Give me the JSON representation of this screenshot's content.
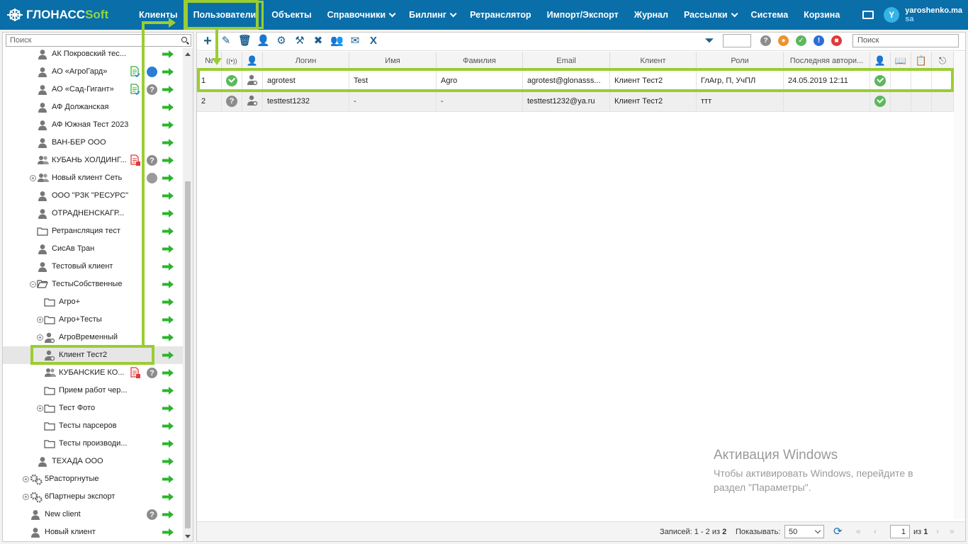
{
  "brand": {
    "name": "ГЛОНАСС",
    "suffix": "Soft"
  },
  "nav": {
    "items": [
      {
        "label": "Клиенты",
        "dropdown": false
      },
      {
        "label": "Пользователи",
        "dropdown": false,
        "active": true
      },
      {
        "label": "Объекты",
        "dropdown": false
      },
      {
        "label": "Справочники",
        "dropdown": true
      },
      {
        "label": "Биллинг",
        "dropdown": true
      },
      {
        "label": "Ретранслятор",
        "dropdown": false
      },
      {
        "label": "Импорт/Экспорт",
        "dropdown": false
      },
      {
        "label": "Журнал",
        "dropdown": false
      },
      {
        "label": "Рассылки",
        "dropdown": true
      },
      {
        "label": "Система",
        "dropdown": false
      },
      {
        "label": "Корзина",
        "dropdown": false
      }
    ]
  },
  "user": {
    "avatar_letter": "Y",
    "login": "yaroshenko.ma",
    "role": "sa"
  },
  "sidebar": {
    "search_placeholder": "Поиск",
    "items": [
      {
        "label": "АК Покровский тес...",
        "icon": "user-icon",
        "indent": 2
      },
      {
        "label": "АО «АгроГард»",
        "icon": "user-icon",
        "indent": 2,
        "doc": "green",
        "badge": "gear"
      },
      {
        "label": "АО «Сад-Гигант»",
        "icon": "user-icon",
        "indent": 2,
        "doc": "green",
        "badge": "?"
      },
      {
        "label": "АФ Должанская",
        "icon": "user-icon",
        "indent": 2
      },
      {
        "label": "АФ Южная Тест 2023",
        "icon": "user-icon",
        "indent": 2
      },
      {
        "label": "ВАН-БЕР ООО",
        "icon": "user-icon",
        "indent": 2
      },
      {
        "label": "КУБАНЬ ХОЛДИНГ...",
        "icon": "users-icon",
        "indent": 2,
        "doc": "red",
        "badge": "?"
      },
      {
        "label": "Новый клиент Сеть",
        "icon": "users-icon",
        "indent": 2,
        "expander": "+",
        "badge": "lock"
      },
      {
        "label": "ООО \"РЗК \"РЕСУРС\"",
        "icon": "user-icon",
        "indent": 2
      },
      {
        "label": "ОТРАДНЕНСКАГР...",
        "icon": "user-icon",
        "indent": 2
      },
      {
        "label": "Ретрансляция тест",
        "icon": "folder-icon",
        "indent": 2
      },
      {
        "label": "СисАв Тран",
        "icon": "user-icon",
        "indent": 2
      },
      {
        "label": "Тестовый клиент",
        "icon": "user-icon",
        "indent": 2
      },
      {
        "label": "ТестыСобственные",
        "icon": "folder-open-icon",
        "indent": 2,
        "expander": "−"
      },
      {
        "label": "Агро+",
        "icon": "folder-icon",
        "indent": 3
      },
      {
        "label": "Агро+Тесты",
        "icon": "folder-icon",
        "indent": 3,
        "expander": "+"
      },
      {
        "label": "АгроВременный",
        "icon": "user-gear-icon",
        "indent": 3,
        "expander": "+"
      },
      {
        "label": "Клиент Тест2",
        "icon": "user-gear-icon",
        "indent": 3,
        "selected": true
      },
      {
        "label": "КУБАНСКИЕ КО...",
        "icon": "users-icon",
        "indent": 3,
        "doc": "red",
        "badge": "?"
      },
      {
        "label": "Прием работ чер...",
        "icon": "folder-icon",
        "indent": 3
      },
      {
        "label": "Тест Фото",
        "icon": "folder-icon",
        "indent": 3,
        "expander": "+"
      },
      {
        "label": "Тесты парсеров",
        "icon": "folder-icon",
        "indent": 3
      },
      {
        "label": "Тесты производи...",
        "icon": "folder-icon",
        "indent": 3
      },
      {
        "label": "ТЕХАДА ООО",
        "icon": "user-icon",
        "indent": 2
      },
      {
        "label": "5Расторгнутые",
        "icon": "gears-icon",
        "indent": 1,
        "expander": "+"
      },
      {
        "label": "6Партнеры экспорт",
        "icon": "gears-icon",
        "indent": 1,
        "expander": "+"
      },
      {
        "label": "New client",
        "icon": "user-icon",
        "indent": 1,
        "badge": "?"
      },
      {
        "label": "Новый клиент",
        "icon": "user-icon",
        "indent": 1
      }
    ]
  },
  "toolbar": {
    "search_placeholder": "Поиск",
    "filter_value": "",
    "buttons": [
      "add-icon",
      "edit-icon",
      "delete-icon",
      "user-settings-icon",
      "vehicle-settings-icon",
      "vehicle-tools-icon",
      "vehicle-delete-icon",
      "group-icon",
      "mail-icon",
      "excel-icon"
    ],
    "status_filters": [
      {
        "name": "unknown-status-icon",
        "glyph": "?",
        "color": "#8c8c8c"
      },
      {
        "name": "hand-status-icon",
        "glyph": "✋",
        "color": "#f0922b"
      },
      {
        "name": "ok-status-icon",
        "glyph": "✓",
        "color": "#5cb85c"
      },
      {
        "name": "warning-status-icon",
        "glyph": "!",
        "color": "#2a6fd6"
      },
      {
        "name": "locked-status-icon",
        "glyph": "🔒",
        "color": "#e03a3a"
      }
    ]
  },
  "table": {
    "columns": [
      "№",
      "",
      "",
      "Логин",
      "Имя",
      "Фамилия",
      "Email",
      "Клиент",
      "Роли",
      "Последняя автори...",
      "",
      "",
      "",
      ""
    ],
    "rows": [
      {
        "num": "1",
        "status": "ok",
        "login": "agrotest",
        "first_name": "Test",
        "last_name": "Agro",
        "email": "agrotest@glonasss...",
        "client": "Клиент Тест2",
        "roles": "ГлАгр, П, УчПЛ",
        "last_auth": "24.05.2019 12:11",
        "active": "ok"
      },
      {
        "num": "2",
        "status": "unknown",
        "login": "testtest1232",
        "first_name": "-",
        "last_name": "-",
        "email": "testtest1232@ya.ru",
        "client": "Клиент Тест2",
        "roles": "ттт",
        "last_auth": "",
        "active": "ok"
      }
    ]
  },
  "footer": {
    "records_label": "Записей:",
    "records_range": "1 - 2 из",
    "records_total": "2",
    "show_label": "Показывать:",
    "page_size": "50",
    "page": "1",
    "of_label": "из",
    "total_pages": "1"
  },
  "watermark": {
    "title": "Активация Windows",
    "line1": "Чтобы активировать Windows, перейдите в",
    "line2": "раздел \"Параметры\"."
  },
  "colors": {
    "topbar": "#0a6ea8",
    "highlight": "#9acd32",
    "arrow": "#2bb52b"
  }
}
